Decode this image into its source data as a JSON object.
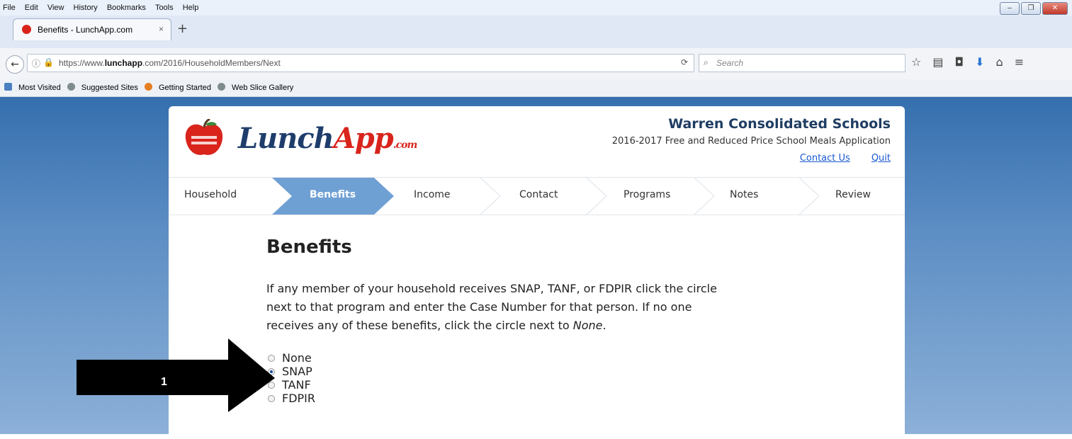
{
  "browser": {
    "menu": [
      "File",
      "Edit",
      "View",
      "History",
      "Bookmarks",
      "Tools",
      "Help"
    ],
    "tab_title": "Benefits - LunchApp.com",
    "tab_close": "×",
    "new_tab": "+",
    "url_host": "https://www.lunchapp.com",
    "url_host_bold": "lunchapp",
    "url_prefix": "https://www.",
    "url_suffix": ".com/2016/HouseholdMembers/Next",
    "search_placeholder": "Search",
    "bookmarks": [
      "Most Visited",
      "Suggested Sites",
      "Getting Started",
      "Web Slice Gallery"
    ]
  },
  "header": {
    "logo_left": "Lunch",
    "logo_right": "App",
    "logo_suffix": ".com",
    "school": "Warren Consolidated Schools",
    "subtitle": "2016-2017 Free and Reduced Price School Meals Application",
    "contact": "Contact Us",
    "quit": "Quit"
  },
  "steps": [
    "Household",
    "Benefits",
    "Income",
    "Contact",
    "Programs",
    "Notes",
    "Review"
  ],
  "active_step": "Benefits",
  "main": {
    "title": "Benefits",
    "intro_line1": "If any member of your household receives SNAP, TANF, or FDPIR click the circle",
    "intro_line2": "next to that program and enter the Case Number for that person. If no one",
    "intro_line3_pre": "receives any of these benefits, click the circle next to ",
    "intro_line3_em": "None",
    "intro_line3_post": ".",
    "options": [
      "None",
      "SNAP",
      "TANF",
      "FDPIR"
    ],
    "selected": "SNAP"
  },
  "annotation": {
    "label": "1"
  },
  "colors": {
    "accent": "#6fa0d4",
    "brand_red": "#d9241c",
    "brand_navy": "#1e3d6b"
  }
}
